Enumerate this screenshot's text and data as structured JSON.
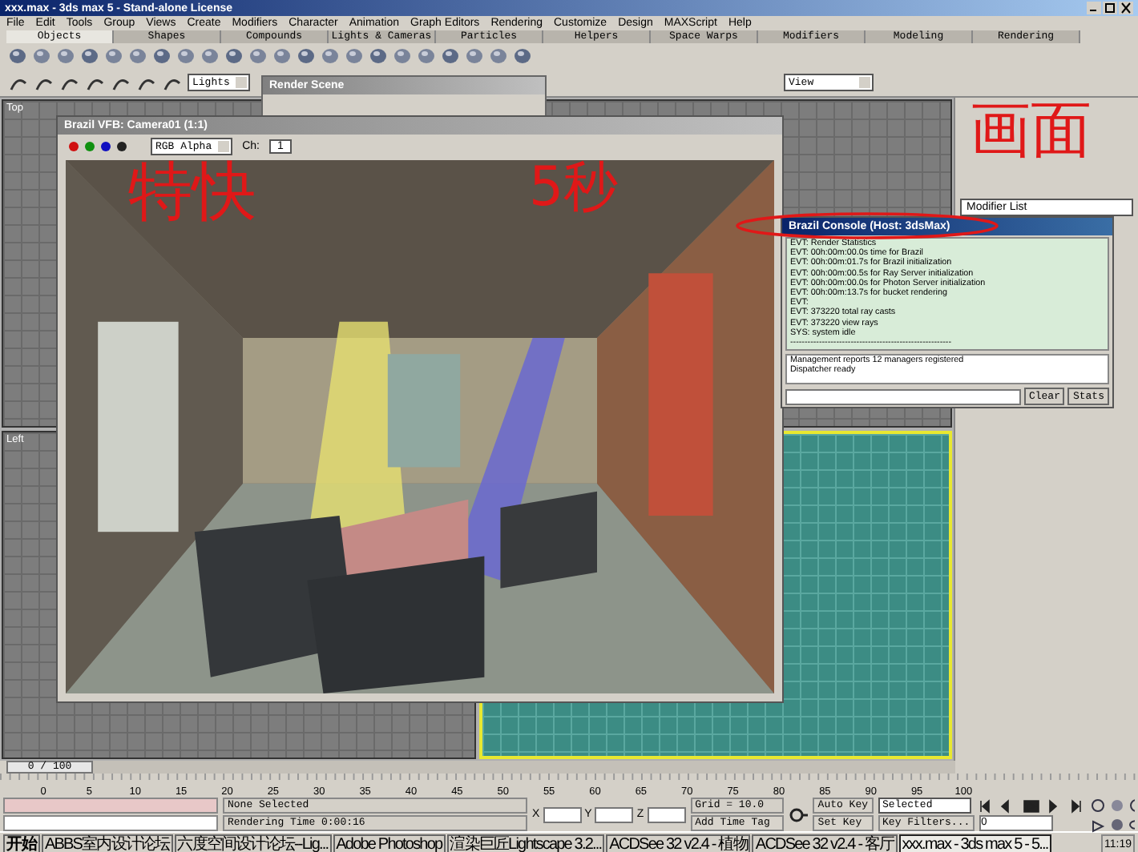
{
  "window": {
    "title": "xxx.max - 3ds max 5 - Stand-alone License"
  },
  "menu": [
    "File",
    "Edit",
    "Tools",
    "Group",
    "Views",
    "Create",
    "Modifiers",
    "Character",
    "Animation",
    "Graph Editors",
    "Rendering",
    "Customize",
    "Design",
    "MAXScript",
    "Help"
  ],
  "tabs": [
    {
      "label": "Objects",
      "selected": true
    },
    {
      "label": "Shapes",
      "selected": false
    },
    {
      "label": "Compounds",
      "selected": false
    },
    {
      "label": "Lights & Cameras",
      "selected": false
    },
    {
      "label": "Particles",
      "selected": false
    },
    {
      "label": "Helpers",
      "selected": false
    },
    {
      "label": "Space Warps",
      "selected": false
    },
    {
      "label": "Modifiers",
      "selected": false
    },
    {
      "label": "Modeling",
      "selected": false
    },
    {
      "label": "Rendering",
      "selected": false
    }
  ],
  "toolbar": {
    "selection_filter": "Lights",
    "view_dropdown": "View"
  },
  "viewports": [
    {
      "label": "Top",
      "active": false
    },
    {
      "active": false
    },
    {
      "label": "Left",
      "active": false
    },
    {
      "active": true
    }
  ],
  "render_scene": {
    "title": "Render Scene"
  },
  "frame_buffer": {
    "title": "Brazil VFB: Camera01 (1:1)",
    "channel_dropdown": "RGB Alpha",
    "channel_label": "Ch:",
    "channel_value": "1"
  },
  "console": {
    "title": "Brazil Console (Host: 3dsMax)",
    "log": [
      "EVT:   Render Statistics",
      "EVT:   00h:00m:00.0s time for Brazil",
      "EVT:   00h:00m:01.7s for Brazil initialization",
      "EVT:   00h:00m:00.5s for Ray Server initialization",
      "EVT:   00h:00m:00.0s for Photon Server initialization",
      "EVT:   00h:00m:13.7s for bucket rendering",
      "EVT:",
      "EVT:   373220 total ray casts",
      "EVT:   373220 view rays",
      "SYS:   system idle",
      "--------------------------------------------------------"
    ],
    "messages": [
      "Management reports 12 managers registered",
      "Dispatcher ready"
    ],
    "buttons": [
      "Clear",
      "Stats"
    ]
  },
  "command_panel": {
    "modifier_list": "Modifier List"
  },
  "timeline": {
    "frame": "0 / 100",
    "level": 0,
    "ticks": [
      "0",
      "5",
      "10",
      "15",
      "20",
      "25",
      "30",
      "35",
      "40",
      "45",
      "50",
      "55",
      "60",
      "65",
      "70",
      "75",
      "80",
      "85",
      "90",
      "95",
      "100"
    ]
  },
  "status": {
    "selection": "None Selected",
    "render_time": "Rendering Time  0:00:16",
    "x_label": "X",
    "y_label": "Y",
    "z_label": "Z",
    "grid": "Grid = 10.0",
    "time_tag": "Add Time Tag",
    "auto_key": "Auto Key",
    "set_key": "Set Key",
    "key_mode": "Selected",
    "key_filters": "Key Filters...",
    "frame_field": "0"
  },
  "taskbar": {
    "start": "开始",
    "tasks": [
      {
        "label": "ABBS室内设计论坛",
        "selected": false
      },
      {
        "label": "六度空间设计论坛--Lig...",
        "selected": false
      },
      {
        "label": "Adobe Photoshop",
        "selected": false
      },
      {
        "label": "渲染巨匠Lightscape 3.2...",
        "selected": false
      },
      {
        "label": "ACDSee 32 v2.4 - 植物",
        "selected": false
      },
      {
        "label": "ACDSee 32 v2.4 - 客厅",
        "selected": false
      },
      {
        "label": "xxx.max - 3ds max 5 - 5...",
        "selected": true
      }
    ],
    "clock": "11:19"
  },
  "annotations": [
    "特快",
    "5秒",
    "画面"
  ]
}
